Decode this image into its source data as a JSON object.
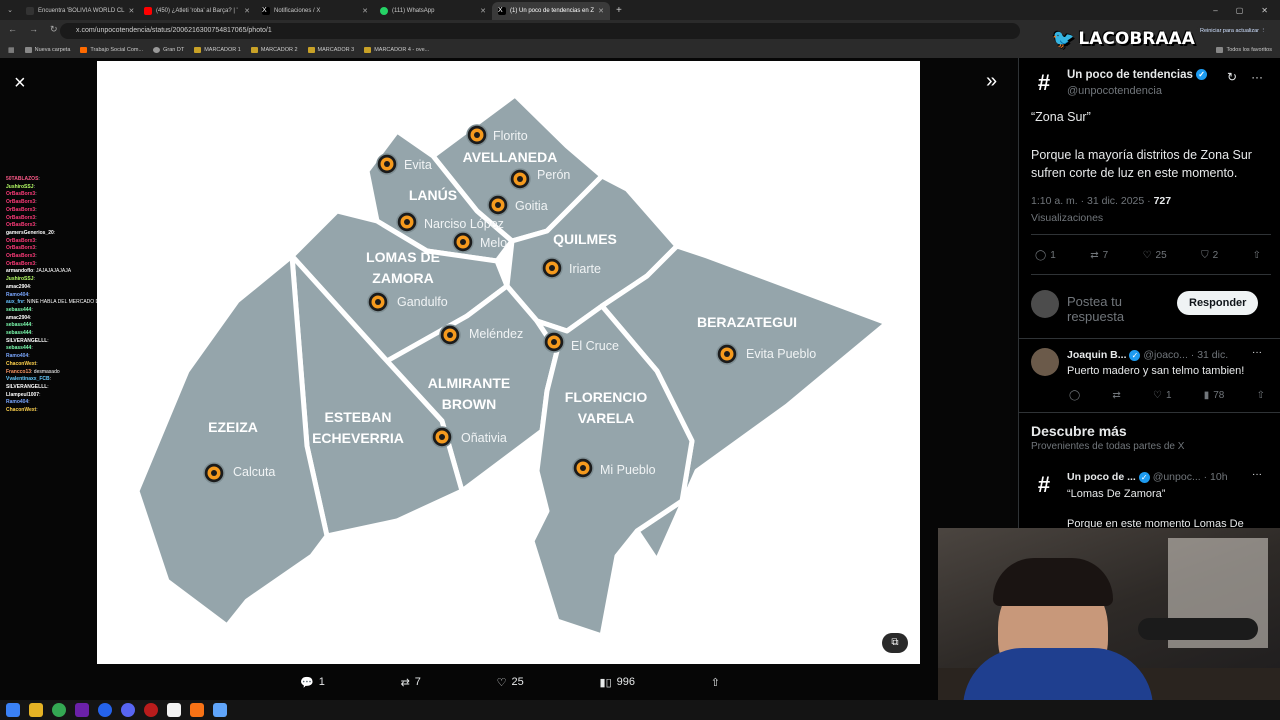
{
  "browser": {
    "tabs": [
      {
        "title": "Encuentra 'BOLIVIA WORLD CL",
        "color": "#ffffff"
      },
      {
        "title": "(450) ¿Atleti 'roba' al Barça? | '",
        "color": "#ff0000"
      },
      {
        "title": "Notificaciones / X",
        "color": "#ffffff"
      },
      {
        "title": "(111) WhatsApp",
        "color": "#25d366"
      },
      {
        "title": "(1) Un poco de tendencias en Z",
        "color": "#ffffff"
      }
    ],
    "new_tab": "+",
    "url": "x.com/unpocotendencia/status/2006216300754817065/photo/1",
    "update_button": "Reiniciar para actualizar",
    "bookmarks": [
      "Nueva carpeta",
      "Trabajo Social Com...",
      "Gran DT",
      "MARCADOR 1",
      "MARCADOR 2",
      "MARCADOR 3",
      "MARCADOR 4 - ove..."
    ],
    "all_bookmarks": "Todos los favoritos"
  },
  "overlay": {
    "logo_text": "LACOBRAAA"
  },
  "viewer": {
    "close": "×",
    "expand": "»",
    "actions": {
      "replies": "1",
      "reposts": "7",
      "likes": "25",
      "views": "996"
    }
  },
  "map": {
    "districts": {
      "avellaneda": "AVELLANEDA",
      "lanus": "LANÚS",
      "lomas1": "LOMAS DE",
      "lomas2": "ZAMORA",
      "quilmes": "QUILMES",
      "berazategui": "BERAZATEGUI",
      "almirante1": "ALMIRANTE",
      "almirante2": "BROWN",
      "florencio1": "FLORENCIO",
      "florencio2": "VARELA",
      "ezeiza": "EZEIZA",
      "esteban1": "ESTEBAN",
      "esteban2": "ECHEVERRIA"
    },
    "localities": {
      "florito": "Florito",
      "evita": "Evita",
      "peron": "Perón",
      "goitia": "Goitia",
      "narciso": "Narciso López",
      "melo": "Melo",
      "iriarte": "Iriarte",
      "gandulfo": "Gandulfo",
      "melendez": "Meléndez",
      "elcruce": "El Cruce",
      "evitapueblo": "Evita Pueblo",
      "onativia": "Oñativia",
      "mipueblo": "Mi Pueblo",
      "calcuta": "Calcuta"
    }
  },
  "chat": [
    {
      "user": "50TABLAZOS",
      "text": ": ",
      "color": "#ff5b8a"
    },
    {
      "user": "JushiroSSJ",
      "text": ": ",
      "color": "#b6ff66"
    },
    {
      "user": "OrBasBorx3",
      "text": ": ",
      "color": "#ff3b7a"
    },
    {
      "user": "OrBasBorx3",
      "text": ": ",
      "color": "#ff3b7a"
    },
    {
      "user": "OrBasBorx3",
      "text": ": ",
      "color": "#ff3b7a"
    },
    {
      "user": "OrBasBorx3",
      "text": ": ",
      "color": "#ff3b7a"
    },
    {
      "user": "OrBasBorx3",
      "text": ": ",
      "color": "#ff3b7a"
    },
    {
      "user": "gamersGenerios_20",
      "text": ": ",
      "color": "#ffffff"
    },
    {
      "user": "OrBasBorx3",
      "text": ": ",
      "color": "#ff3b7a"
    },
    {
      "user": "OrBasBorx3",
      "text": ": ",
      "color": "#ff3b7a"
    },
    {
      "user": "OrBasBorx3",
      "text": ": ",
      "color": "#ff3b7a"
    },
    {
      "user": "OrBasBorx3",
      "text": ": ",
      "color": "#ff3b7a"
    },
    {
      "user": "armandoflo",
      "text": ": JAJAJAJAJAJA",
      "color": "#ffffff"
    },
    {
      "user": "JushiroSSJ",
      "text": ": ",
      "color": "#b6ff66"
    },
    {
      "user": "amac2904",
      "text": ": ",
      "color": "#ffffff"
    },
    {
      "user": "Ramo404",
      "text": ": ",
      "color": "#7aa7ff"
    },
    {
      "user": "aux_fnr",
      "text": ": NINE HABLA DEL MERCADO DE NUESTRA BABA",
      "color": "#66c2ff"
    },
    {
      "user": "sebass444",
      "text": ": ",
      "color": "#7dffb0"
    },
    {
      "user": "amac2904",
      "text": ": ",
      "color": "#ffffff"
    },
    {
      "user": "sebass444",
      "text": ": ",
      "color": "#7dffb0"
    },
    {
      "user": "sebass444",
      "text": ": ",
      "color": "#7dffb0"
    },
    {
      "user": "SILVERANGELLL",
      "text": ": ",
      "color": "#ffffff"
    },
    {
      "user": "sebass444",
      "text": ": ",
      "color": "#7dffb0"
    },
    {
      "user": "Ramo404",
      "text": ": ",
      "color": "#7aa7ff"
    },
    {
      "user": "ChaconWext",
      "text": ": ",
      "color": "#ffd24d"
    },
    {
      "user": "Francco13",
      "text": ": desmasado",
      "color": "#ff9966"
    },
    {
      "user": "Vvalentinaxx_FCB",
      "text": ": ",
      "color": "#66ccff"
    },
    {
      "user": "SILVERANGELLL",
      "text": ": ",
      "color": "#ffffff"
    },
    {
      "user": "Llampeul1007",
      "text": ": ",
      "color": "#ffffff"
    },
    {
      "user": "Ramo404",
      "text": ": ",
      "color": "#7aa7ff"
    },
    {
      "user": "ChaconWext",
      "text": ": ",
      "color": "#ffd24d"
    }
  ],
  "panel": {
    "author": "Un poco de tendencias",
    "handle": "@unpocotendencia",
    "post_title": "“Zona Sur”",
    "post_body": "Porque la mayoría distritos de Zona Sur sufren corte de luz en este momento.",
    "meta": "1:10 a. m. · 31 dic. 2025 · ",
    "views_count": "727",
    "views_label": "Visualizaciones",
    "stats": {
      "replies": "1",
      "reposts": "7",
      "likes": "25",
      "bookmarks": "2"
    },
    "reply_placeholder": "Postea tu respuesta",
    "reply_button": "Responder",
    "reply": {
      "author": "Joaquin B...",
      "handle": "@joaco...",
      "date": "· 31 dic.",
      "text": "Puerto madero y san telmo tambien!",
      "stats": {
        "likes": "1",
        "views": "78"
      }
    },
    "discover_title": "Descubre más",
    "discover_sub": "Provenientes de todas partes de X",
    "suggested": {
      "author": "Un poco de ...",
      "handle": "@unpoc...",
      "time": "· 10h",
      "title": "“Lomas De Zamora”",
      "body": "Porque en este momento Lomas De"
    }
  }
}
